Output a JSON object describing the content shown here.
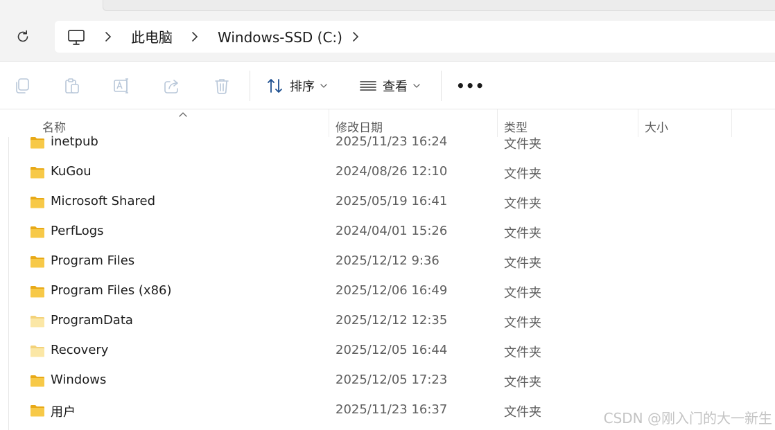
{
  "address": {
    "crumbs": [
      "此电脑",
      "Windows-SSD (C:)"
    ]
  },
  "toolbar": {
    "icons": [
      "copy-icon",
      "paste-icon",
      "rename-icon",
      "share-icon",
      "delete-icon"
    ],
    "sort_label": "排序",
    "view_label": "查看",
    "more_label": "•••"
  },
  "columns": {
    "name": "名称",
    "date": "修改日期",
    "type": "类型",
    "size": "大小"
  },
  "files": [
    {
      "name": "inetpub",
      "date": "2025/11/23 16:24",
      "type": "文件夹",
      "hidden": false
    },
    {
      "name": "KuGou",
      "date": "2024/08/26 12:10",
      "type": "文件夹",
      "hidden": false
    },
    {
      "name": "Microsoft Shared",
      "date": "2025/05/19 16:41",
      "type": "文件夹",
      "hidden": false
    },
    {
      "name": "PerfLogs",
      "date": "2024/04/01 15:26",
      "type": "文件夹",
      "hidden": false
    },
    {
      "name": "Program Files",
      "date": "2025/12/12 9:36",
      "type": "文件夹",
      "hidden": false
    },
    {
      "name": "Program Files (x86)",
      "date": "2025/12/06 16:49",
      "type": "文件夹",
      "hidden": false
    },
    {
      "name": "ProgramData",
      "date": "2025/12/12 12:35",
      "type": "文件夹",
      "hidden": true
    },
    {
      "name": "Recovery",
      "date": "2025/12/05 16:44",
      "type": "文件夹",
      "hidden": true
    },
    {
      "name": "Windows",
      "date": "2025/12/05 17:23",
      "type": "文件夹",
      "hidden": false
    },
    {
      "name": "用户",
      "date": "2025/11/23 16:37",
      "type": "文件夹",
      "hidden": false
    }
  ],
  "watermark": "CSDN @刚入门的大一新生",
  "colors": {
    "folder": "#f7c948",
    "folder_dark": "#e8a917",
    "folder_hidden": "#fbe7a6",
    "folder_hidden_dark": "#f3d27a"
  }
}
